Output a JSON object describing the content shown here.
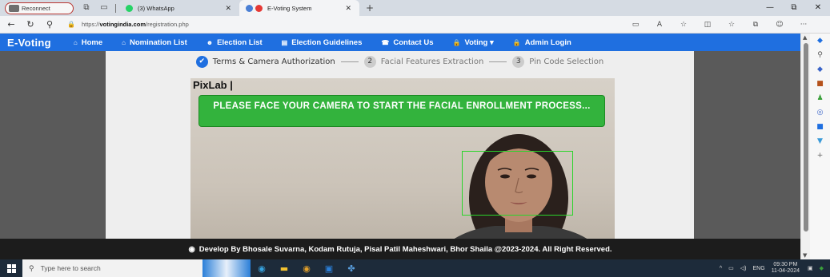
{
  "browser": {
    "reconnect_label": "Reconnect",
    "tabs": [
      {
        "title": "(3) WhatsApp",
        "dot_color": "#25d366"
      },
      {
        "title": "E-Voting System",
        "dot_color": "#e53935"
      }
    ],
    "url_prefix": "https://",
    "url_domain": "votingindia.com",
    "url_path": "/registration.php"
  },
  "site": {
    "brand": "E-Voting",
    "nav": [
      {
        "icon": "home-icon",
        "glyph": "⌂",
        "label": "Home"
      },
      {
        "icon": "home-icon",
        "glyph": "⌂",
        "label": "Nomination List"
      },
      {
        "icon": "users-icon",
        "glyph": "☻",
        "label": "Election List"
      },
      {
        "icon": "list-icon",
        "glyph": "▤",
        "label": "Election Guidelines"
      },
      {
        "icon": "phone-icon",
        "glyph": "☎",
        "label": "Contact Us"
      },
      {
        "icon": "lock-icon",
        "glyph": "🔒",
        "label": "Voting ▾"
      },
      {
        "icon": "lock-icon",
        "glyph": "🔒",
        "label": "Admin Login"
      }
    ],
    "accent_color": "#1f6fe0"
  },
  "stepper": [
    {
      "number": "✔",
      "label": "Terms & Camera Authorization",
      "done": true
    },
    {
      "number": "2",
      "label": "Facial Features Extraction",
      "done": false
    },
    {
      "number": "3",
      "label": "Pin Code Selection",
      "done": false
    }
  ],
  "camera": {
    "overlay_title": "PixLab |",
    "banner_text": "PLEASE FACE YOUR CAMERA TO START THE FACIAL ENROLLMENT PROCESS...",
    "banner_color": "#33b33d",
    "face_box_color": "#2ad42a"
  },
  "footer": {
    "text": "Develop By Bhosale Suvarna, Kodam Rutuja, Pisal Patil Maheshwari, Bhor Shaila @2023-2024. All Right Reserved."
  },
  "taskbar": {
    "search_placeholder": "Type here to search",
    "language": "ENG",
    "time": "09:30 PM",
    "date": "11-04-2024"
  }
}
